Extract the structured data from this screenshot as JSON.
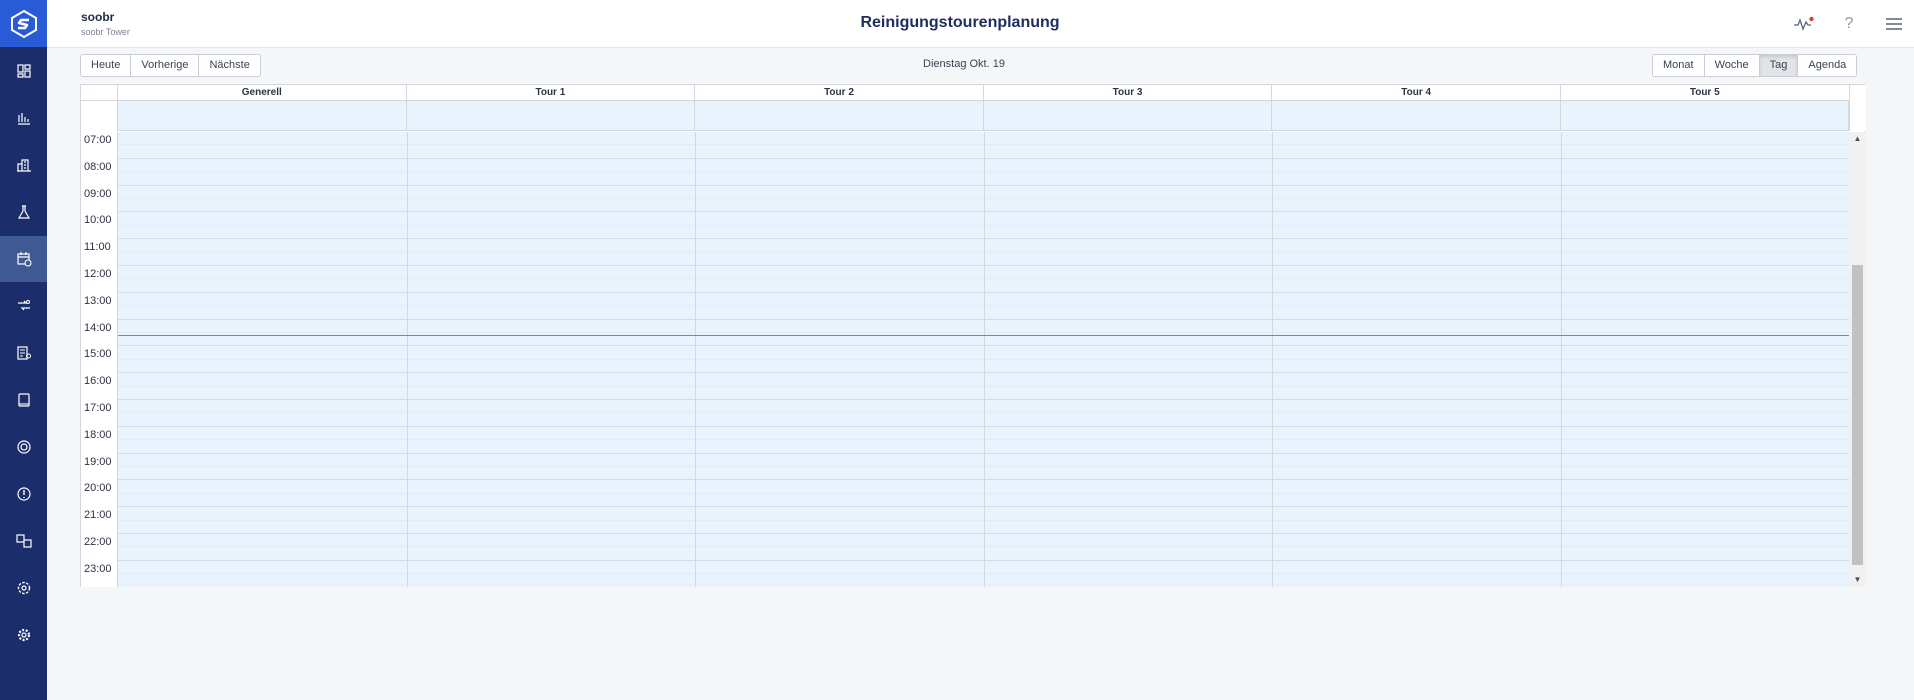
{
  "colors": {
    "sidebar": "#1b2d6b",
    "logo": "#2a5bd7",
    "accent_now": "#4caf50",
    "slot_bg": "#e8f3fd"
  },
  "header": {
    "org_name": "soobr",
    "org_sub": "soobr Tower",
    "title": "Reinigungstourenplanung",
    "icons": [
      "activity-icon",
      "help-icon",
      "menu-icon"
    ]
  },
  "sidebar": {
    "items": [
      {
        "name": "dashboard-icon"
      },
      {
        "name": "bar-chart-icon"
      },
      {
        "name": "building-icon"
      },
      {
        "name": "flask-icon"
      },
      {
        "name": "calendar-icon",
        "active": true
      },
      {
        "name": "swap-users-icon"
      },
      {
        "name": "report-icon"
      },
      {
        "name": "tablet-icon"
      },
      {
        "name": "target-icon"
      },
      {
        "name": "alert-icon"
      },
      {
        "name": "translate-icon"
      },
      {
        "name": "settings-cog-icon"
      },
      {
        "name": "gear-icon"
      }
    ]
  },
  "toolbar": {
    "today": "Heute",
    "previous": "Vorherige",
    "next": "Nächste",
    "date": "Dienstag Okt. 19",
    "views": [
      "Monat",
      "Woche",
      "Tag",
      "Agenda"
    ],
    "active_view": "Tag"
  },
  "calendar": {
    "columns": [
      "Generell",
      "Tour 1",
      "Tour 2",
      "Tour 3",
      "Tour 4",
      "Tour 5"
    ],
    "hours": [
      "07:00",
      "08:00",
      "09:00",
      "10:00",
      "11:00",
      "12:00",
      "13:00",
      "14:00",
      "15:00",
      "16:00",
      "17:00",
      "18:00",
      "19:00",
      "20:00",
      "21:00",
      "22:00",
      "23:00"
    ],
    "scroll_fraction_visible": 0.66
  }
}
